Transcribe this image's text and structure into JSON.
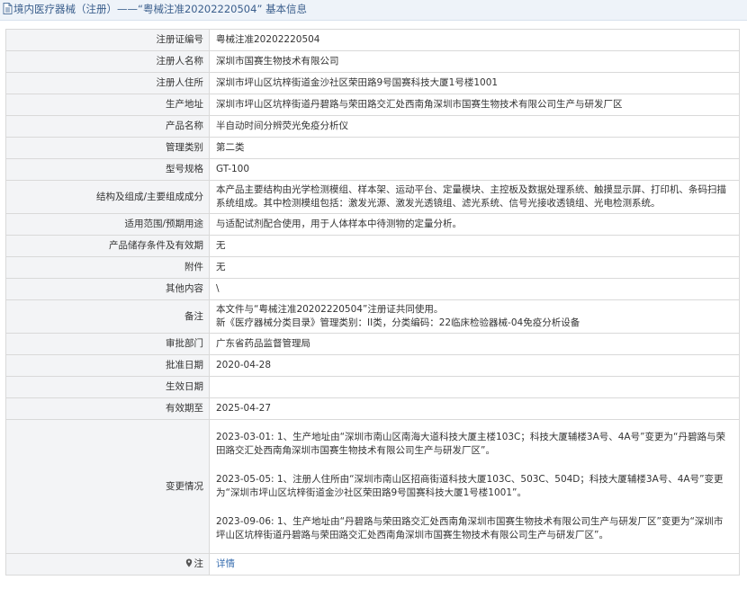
{
  "header": {
    "section": "境内医疗器械（注册）",
    "separator": "——",
    "record": "“粤械注准20202220504”",
    "suffix": "基本信息"
  },
  "rows": [
    {
      "key": "reg_no",
      "label": "注册证编号",
      "value": "粤械注准20202220504"
    },
    {
      "key": "registrant",
      "label": "注册人名称",
      "value": "深圳市国赛生物技术有限公司"
    },
    {
      "key": "registrant_addr",
      "label": "注册人住所",
      "value": "深圳市坪山区坑梓街道金沙社区荣田路9号国赛科技大厦1号楼1001"
    },
    {
      "key": "production_addr",
      "label": "生产地址",
      "value": "深圳市坪山区坑梓街道丹碧路与荣田路交汇处西南角深圳市国赛生物技术有限公司生产与研发厂区"
    },
    {
      "key": "product_name",
      "label": "产品名称",
      "value": "半自动时间分辨荧光免疫分析仪"
    },
    {
      "key": "category",
      "label": "管理类别",
      "value": "第二类"
    },
    {
      "key": "model",
      "label": "型号规格",
      "value": "GT-100"
    },
    {
      "key": "structure",
      "label": "结构及组成/主要组成成分",
      "value": "本产品主要结构由光学检测模组、样本架、运动平台、定量模块、主控板及数据处理系统、触摸显示屏、打印机、条码扫描系统组成。其中检测模组包括：激发光源、激发光透镜组、滤光系统、信号光接收透镜组、光电检测系统。"
    },
    {
      "key": "scope",
      "label": "适用范围/预期用途",
      "value": "与适配试剂配合使用，用于人体样本中待测物的定量分析。"
    },
    {
      "key": "storage",
      "label": "产品储存条件及有效期",
      "value": "无"
    },
    {
      "key": "attachment",
      "label": "附件",
      "value": "无"
    },
    {
      "key": "other",
      "label": "其他内容",
      "value": "\\"
    },
    {
      "key": "remark",
      "label": "备注",
      "lines": [
        "本文件与“粤械注准20202220504”注册证共同使用。",
        "新《医疗器械分类目录》管理类别：II类，分类编码：22临床检验器械-04免疫分析设备"
      ]
    },
    {
      "key": "approver",
      "label": "审批部门",
      "value": "广东省药品监督管理局"
    },
    {
      "key": "approve_date",
      "label": "批准日期",
      "value": "2020-04-28"
    },
    {
      "key": "effective_date",
      "label": "生效日期",
      "value": ""
    },
    {
      "key": "expiry",
      "label": "有效期至",
      "value": "2025-04-27"
    },
    {
      "key": "changes",
      "label": "变更情况",
      "paragraphs": [
        "2023-03-01: 1、生产地址由“深圳市南山区南海大道科技大厦主楼103C；科技大厦辅楼3A号、4A号”变更为“丹碧路与荣田路交汇处西南角深圳市国赛生物技术有限公司生产与研发厂区”。",
        "2023-05-05: 1、注册人住所由“深圳市南山区招商街道科技大厦103C、503C、504D；科技大厦辅楼3A号、4A号”变更为“深圳市坪山区坑梓街道金沙社区荣田路9号国赛科技大厦1号楼1001”。",
        "2023-09-06: 1、生产地址由“丹碧路与荣田路交汇处西南角深圳市国赛生物技术有限公司生产与研发厂区”变更为“深圳市坪山区坑梓街道丹碧路与荣田路交汇处西南角深圳市国赛生物技术有限公司生产与研发厂区”。"
      ]
    },
    {
      "key": "note",
      "label": "注",
      "value": "详情"
    }
  ],
  "colors": {
    "link": "#3a6fb0",
    "label_bg": "#f3f4f6",
    "border": "#d9d9d9",
    "title_bg": "#eef3f9"
  }
}
